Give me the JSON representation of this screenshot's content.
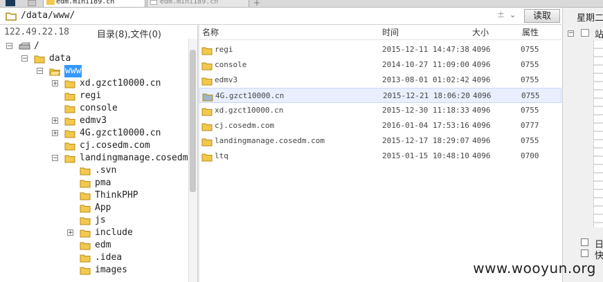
{
  "tabs": [
    {
      "label": "edm.mini189.cn",
      "active": true
    },
    {
      "label": "edm.mini189.cn",
      "active": false
    }
  ],
  "path": {
    "value": "/data/www/",
    "read_button": "读取"
  },
  "right_panel": {
    "header": "星期二",
    "site_label": "站",
    "bottom1": "日",
    "bottom2": "快"
  },
  "left": {
    "ip": "122.49.22.18",
    "summary": "目录(8),文件(0)"
  },
  "tree": [
    {
      "label": "/",
      "depth": 0,
      "expander": "−",
      "icon": "drive"
    },
    {
      "label": "data",
      "depth": 1,
      "expander": "−",
      "icon": "folder"
    },
    {
      "label": "www",
      "depth": 2,
      "expander": "−",
      "icon": "folder-open",
      "selected": true
    },
    {
      "label": "xd.gzct10000.cn",
      "depth": 3,
      "expander": "+",
      "icon": "folder"
    },
    {
      "label": "regi",
      "depth": 3,
      "expander": "",
      "icon": "folder"
    },
    {
      "label": "console",
      "depth": 3,
      "expander": "",
      "icon": "folder"
    },
    {
      "label": "edmv3",
      "depth": 3,
      "expander": "+",
      "icon": "folder"
    },
    {
      "label": "4G.gzct10000.cn",
      "depth": 3,
      "expander": "+",
      "icon": "folder"
    },
    {
      "label": "cj.cosedm.com",
      "depth": 3,
      "expander": "",
      "icon": "folder"
    },
    {
      "label": "landingmanage.cosedm",
      "depth": 3,
      "expander": "−",
      "icon": "folder"
    },
    {
      "label": ".svn",
      "depth": 4,
      "expander": "",
      "icon": "folder"
    },
    {
      "label": "pma",
      "depth": 4,
      "expander": "",
      "icon": "folder"
    },
    {
      "label": "ThinkPHP",
      "depth": 4,
      "expander": "",
      "icon": "folder"
    },
    {
      "label": "App",
      "depth": 4,
      "expander": "",
      "icon": "folder"
    },
    {
      "label": "js",
      "depth": 4,
      "expander": "",
      "icon": "folder"
    },
    {
      "label": "include",
      "depth": 4,
      "expander": "+",
      "icon": "folder"
    },
    {
      "label": "edm",
      "depth": 4,
      "expander": "",
      "icon": "folder"
    },
    {
      "label": ".idea",
      "depth": 4,
      "expander": "",
      "icon": "folder"
    },
    {
      "label": "images",
      "depth": 4,
      "expander": "",
      "icon": "folder"
    }
  ],
  "columns": {
    "name": "名称",
    "time": "时间",
    "size": "大小",
    "attr": "属性"
  },
  "rows": [
    {
      "name": "regi",
      "time": "2015-12-11 14:47:38",
      "size": "4096",
      "attr": "0755"
    },
    {
      "name": "console",
      "time": "2014-10-27 11:09:00",
      "size": "4096",
      "attr": "0755"
    },
    {
      "name": "edmv3",
      "time": "2013-08-01 01:02:42",
      "size": "4096",
      "attr": "0755"
    },
    {
      "name": "4G.gzct10000.cn",
      "time": "2015-12-21 18:06:20",
      "size": "4096",
      "attr": "0755",
      "selected": true
    },
    {
      "name": "xd.gzct10000.cn",
      "time": "2015-12-30 11:18:33",
      "size": "4096",
      "attr": "0755"
    },
    {
      "name": "cj.cosedm.com",
      "time": "2016-01-04 17:53:16",
      "size": "4096",
      "attr": "0777"
    },
    {
      "name": "landingmanage.cosedm.com",
      "time": "2015-12-17 18:29:07",
      "size": "4096",
      "attr": "0755"
    },
    {
      "name": "ltq",
      "time": "2015-01-15 10:48:10",
      "size": "4096",
      "attr": "0700"
    }
  ],
  "watermark": "www.wooyun.org",
  "colors": {
    "folder": "#f2c94c",
    "folder_selected": "#9fb7c9",
    "selection": "#3399ff"
  }
}
